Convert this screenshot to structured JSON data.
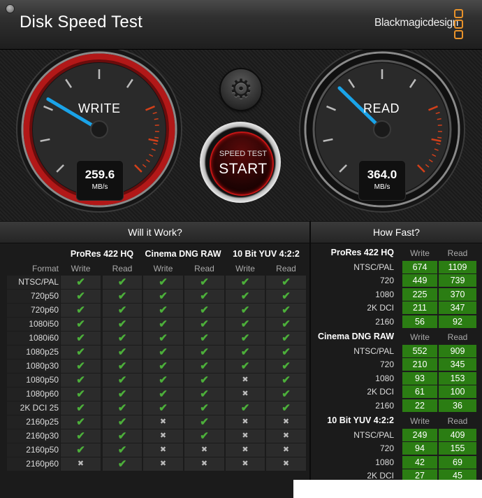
{
  "window": {
    "title": "Disk Speed Test",
    "brand": "Blackmagicdesign"
  },
  "gauges": {
    "write": {
      "label": "WRITE",
      "value": "259.6",
      "unit": "MB/s",
      "needle_fraction": 0.28
    },
    "read": {
      "label": "READ",
      "value": "364.0",
      "unit": "MB/s",
      "needle_fraction": 0.33
    }
  },
  "start_button": {
    "small": "SPEED TEST",
    "big": "START"
  },
  "will_it_work": {
    "title": "Will it Work?",
    "format_header": "Format",
    "groups": [
      "ProRes 422 HQ",
      "Cinema DNG RAW",
      "10 Bit YUV 4:2:2"
    ],
    "col_write": "Write",
    "col_read": "Read",
    "rows": [
      {
        "format": "NTSC/PAL",
        "r": [
          1,
          1,
          1,
          1,
          1,
          1
        ]
      },
      {
        "format": "720p50",
        "r": [
          1,
          1,
          1,
          1,
          1,
          1
        ]
      },
      {
        "format": "720p60",
        "r": [
          1,
          1,
          1,
          1,
          1,
          1
        ]
      },
      {
        "format": "1080i50",
        "r": [
          1,
          1,
          1,
          1,
          1,
          1
        ]
      },
      {
        "format": "1080i60",
        "r": [
          1,
          1,
          1,
          1,
          1,
          1
        ]
      },
      {
        "format": "1080p25",
        "r": [
          1,
          1,
          1,
          1,
          1,
          1
        ]
      },
      {
        "format": "1080p30",
        "r": [
          1,
          1,
          1,
          1,
          1,
          1
        ]
      },
      {
        "format": "1080p50",
        "r": [
          1,
          1,
          1,
          1,
          0,
          1
        ]
      },
      {
        "format": "1080p60",
        "r": [
          1,
          1,
          1,
          1,
          0,
          1
        ]
      },
      {
        "format": "2K DCI 25",
        "r": [
          1,
          1,
          1,
          1,
          1,
          1
        ]
      },
      {
        "format": "2160p25",
        "r": [
          1,
          1,
          0,
          1,
          0,
          0
        ]
      },
      {
        "format": "2160p30",
        "r": [
          1,
          1,
          0,
          1,
          0,
          0
        ]
      },
      {
        "format": "2160p50",
        "r": [
          1,
          1,
          0,
          0,
          0,
          0
        ]
      },
      {
        "format": "2160p60",
        "r": [
          0,
          1,
          0,
          0,
          0,
          0
        ]
      }
    ]
  },
  "how_fast": {
    "title": "How Fast?",
    "col_write": "Write",
    "col_read": "Read",
    "groups": [
      {
        "name": "ProRes 422 HQ",
        "rows": [
          {
            "label": "NTSC/PAL",
            "write": "674",
            "read": "1109"
          },
          {
            "label": "720",
            "write": "449",
            "read": "739"
          },
          {
            "label": "1080",
            "write": "225",
            "read": "370"
          },
          {
            "label": "2K DCI",
            "write": "211",
            "read": "347"
          },
          {
            "label": "2160",
            "write": "56",
            "read": "92"
          }
        ]
      },
      {
        "name": "Cinema DNG RAW",
        "rows": [
          {
            "label": "NTSC/PAL",
            "write": "552",
            "read": "909"
          },
          {
            "label": "720",
            "write": "210",
            "read": "345"
          },
          {
            "label": "1080",
            "write": "93",
            "read": "153"
          },
          {
            "label": "2K DCI",
            "write": "61",
            "read": "100"
          },
          {
            "label": "2160",
            "write": "22",
            "read": "36"
          }
        ]
      },
      {
        "name": "10 Bit YUV 4:2:2",
        "rows": [
          {
            "label": "NTSC/PAL",
            "write": "249",
            "read": "409"
          },
          {
            "label": "720",
            "write": "94",
            "read": "155"
          },
          {
            "label": "1080",
            "write": "42",
            "read": "69"
          },
          {
            "label": "2K DCI",
            "write": "27",
            "read": "45"
          }
        ]
      }
    ]
  },
  "colors": {
    "accent_red": "#c21515",
    "needle_blue": "#1aa3e8",
    "good_green": "#2b7d13",
    "check_green": "#4caf3a"
  },
  "icons": {
    "yes": "check-icon",
    "no": "cross-icon",
    "settings": "gear-icon"
  },
  "glyphs": {
    "yes": "✔",
    "no": "✖",
    "gear": "⚙"
  }
}
